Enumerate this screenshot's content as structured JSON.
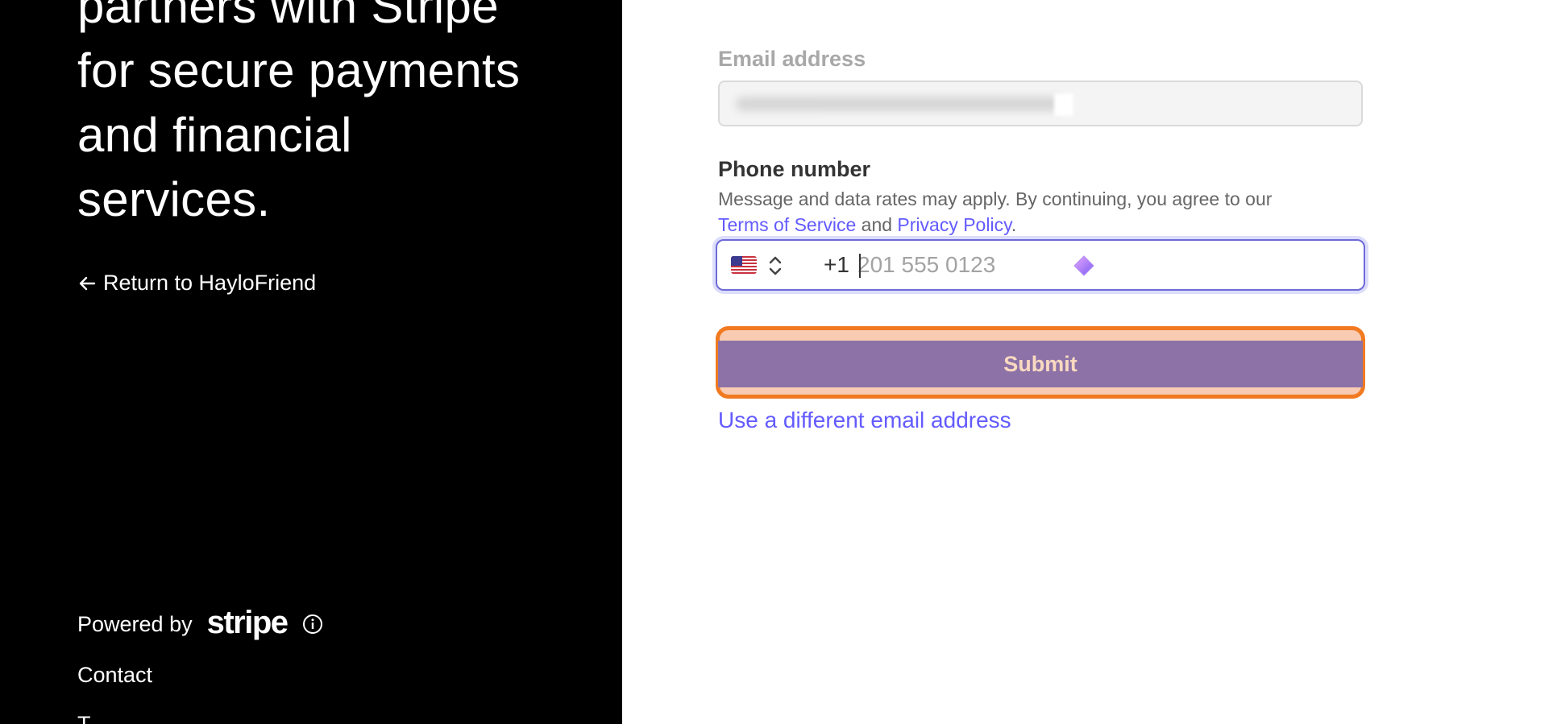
{
  "left_panel": {
    "headline_lines": [
      "partners with Stripe",
      "for secure payments",
      "and financial",
      "services."
    ],
    "return_link": "Return to HayloFriend",
    "powered_by": "Powered by",
    "stripe_logo": "stripe",
    "contact": "Contact",
    "terms_cut": "T"
  },
  "form": {
    "email_label": "Email address",
    "phone_label": "Phone number",
    "help_text_before": "Message and data rates may apply. By continuing, you agree to our",
    "terms_link": "Terms of Service",
    "and_text": "and",
    "privacy_link": "Privacy Policy",
    "period": ".",
    "country_flag_icon": "us-flag-icon",
    "country_code": "+1",
    "phone_placeholder": "201 555 0123",
    "phone_value": "",
    "submit_label": "Submit",
    "different_email_link": "Use a different email address"
  },
  "colors": {
    "link": "#635bff",
    "submit_bg": "#8d72a7",
    "focus_ring": "#f17a21"
  }
}
